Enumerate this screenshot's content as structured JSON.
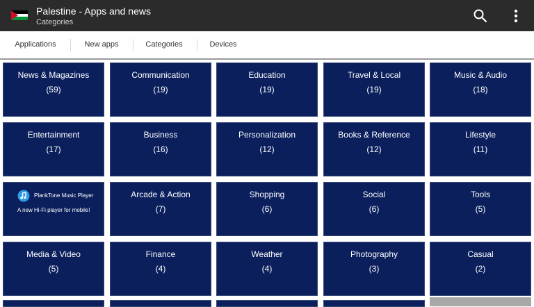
{
  "appbar": {
    "title": "Palestine - Apps and news",
    "subtitle": "Categories",
    "icons": [
      "flag-icon",
      "search-icon",
      "overflow-menu-icon"
    ],
    "background": "#2b2b2b"
  },
  "tabs": [
    {
      "label": "Applications"
    },
    {
      "label": "New apps"
    },
    {
      "label": "Categories"
    },
    {
      "label": "Devices"
    }
  ],
  "tiles": [
    {
      "name": "News & Magazines",
      "count": "(59)"
    },
    {
      "name": "Communication",
      "count": "(19)"
    },
    {
      "name": "Education",
      "count": "(19)"
    },
    {
      "name": "Travel & Local",
      "count": "(19)"
    },
    {
      "name": "Music & Audio",
      "count": "(18)"
    },
    {
      "name": "Entertainment",
      "count": "(17)"
    },
    {
      "name": "Business",
      "count": "(16)"
    },
    {
      "name": "Personalization",
      "count": "(12)"
    },
    {
      "name": "Books & Reference",
      "count": "(12)"
    },
    {
      "name": "Lifestyle",
      "count": "(11)"
    },
    {
      "name": "Arcade & Action",
      "count": "(7)"
    },
    {
      "name": "Shopping",
      "count": "(6)"
    },
    {
      "name": "Social",
      "count": "(6)"
    },
    {
      "name": "Tools",
      "count": "(5)"
    },
    {
      "name": "Media & Video",
      "count": "(5)"
    },
    {
      "name": "Finance",
      "count": "(4)"
    },
    {
      "name": "Weather",
      "count": "(4)"
    },
    {
      "name": "Photography",
      "count": "(3)"
    },
    {
      "name": "Casual",
      "count": "(2)"
    }
  ],
  "ad": {
    "title": "PlankTone Music Player",
    "description": "A new Hi-Fi player for mobile!",
    "icon": "music-note-icon"
  },
  "colors": {
    "tile": "#0a1f5c",
    "flag_black": "#000000",
    "flag_white": "#ffffff",
    "flag_green": "#009639",
    "flag_red": "#ce1126"
  }
}
